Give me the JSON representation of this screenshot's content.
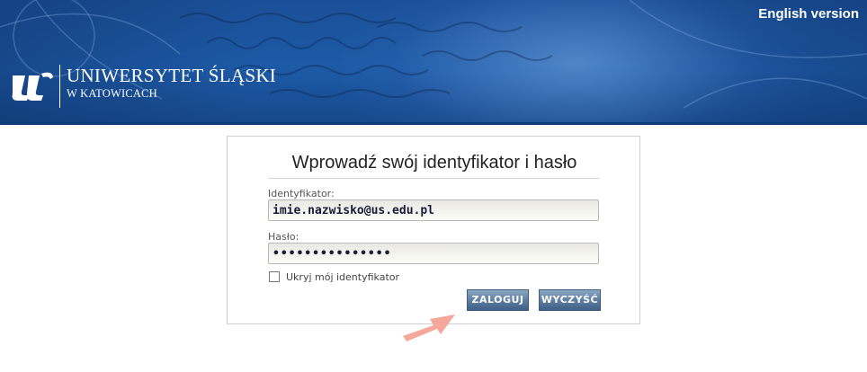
{
  "header": {
    "language_link": "English version",
    "logo_title": "UNIWERSYTET ŚLĄSKI",
    "logo_subtitle": "W KATOWICACH",
    "brand_color": "#1d5aa6"
  },
  "login": {
    "title": "Wprowadź swój identyfikator i hasło",
    "username_label": "Identyfikator:",
    "username_value": "imie.nazwisko@us.edu.pl",
    "password_label": "Hasło:",
    "password_value": "•••••••••••••••",
    "remember_label": "Ukryj mój identyfikator",
    "remember_checked": false,
    "login_button": "ZALOGUJ",
    "clear_button": "WYCZYŚĆ",
    "button_color": "#5f7fa3"
  },
  "annotation": {
    "arrow_color": "#f4a79a",
    "arrow_icon": "pointer-arrow-icon"
  }
}
